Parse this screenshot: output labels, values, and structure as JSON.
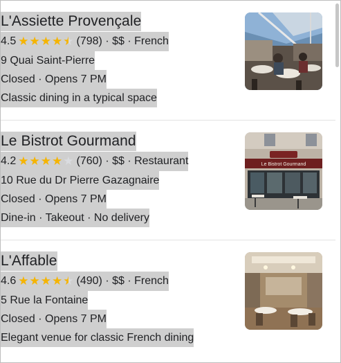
{
  "results": [
    {
      "name": "L'Assiette Provençale",
      "rating": "4.5",
      "rating_value": 4.5,
      "reviews": "(798)",
      "price": "$$",
      "category": "French",
      "address": "9 Quai Saint-Pierre",
      "status": "Closed",
      "hours": "Opens 7 PM",
      "description": "Classic dining in a typical space"
    },
    {
      "name": "Le Bistrot Gourmand",
      "rating": "4.2",
      "rating_value": 4.2,
      "reviews": "(760)",
      "price": "$$",
      "category": "Restaurant",
      "address": "10 Rue du Dr Pierre Gazagnaire",
      "status": "Closed",
      "hours": "Opens 7 PM",
      "services": [
        "Dine-in",
        "Takeout",
        "No delivery"
      ],
      "photo_sign": "Le Bistrot Gourmand"
    },
    {
      "name": "L'Affable",
      "rating": "4.6",
      "rating_value": 4.6,
      "reviews": "(490)",
      "price": "$$",
      "category": "French",
      "address": "5 Rue la Fontaine",
      "status": "Closed",
      "hours": "Opens 7 PM",
      "description": "Elegant venue for classic French dining"
    }
  ],
  "separator": "·",
  "colors": {
    "star": "#f5b400",
    "star_empty": "#dadce0",
    "highlight": "#cfcfcf",
    "text": "#202124"
  },
  "icons": [
    "star-icon",
    "half-star-icon"
  ]
}
